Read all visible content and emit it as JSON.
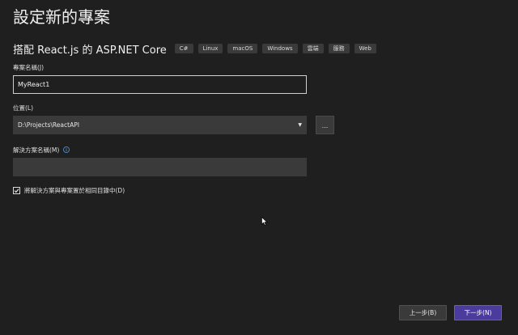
{
  "header": {
    "title": "設定新的專案",
    "template_name": "搭配 React.js 的 ASP.NET Core",
    "tags": [
      "C#",
      "Linux",
      "macOS",
      "Windows",
      "雲端",
      "服務",
      "Web"
    ]
  },
  "form": {
    "project_name": {
      "label": "專案名稱(J)",
      "value": "MyReact1"
    },
    "location": {
      "label": "位置(L)",
      "value": "D:\\Projects\\ReactAPI",
      "browse_label": "..."
    },
    "solution_name": {
      "label": "解決方案名稱(M)",
      "value": ""
    },
    "same_directory": {
      "label": "將解決方案與專案置於相同目錄中(D)",
      "checked": true
    }
  },
  "footer": {
    "back_label": "上一步(B)",
    "next_label": "下一步(N)"
  },
  "colors": {
    "background": "#1f1f1f",
    "field_background": "#3a3a3a",
    "primary_button": "#4b3b9c",
    "info_icon": "#5aa0e6"
  }
}
